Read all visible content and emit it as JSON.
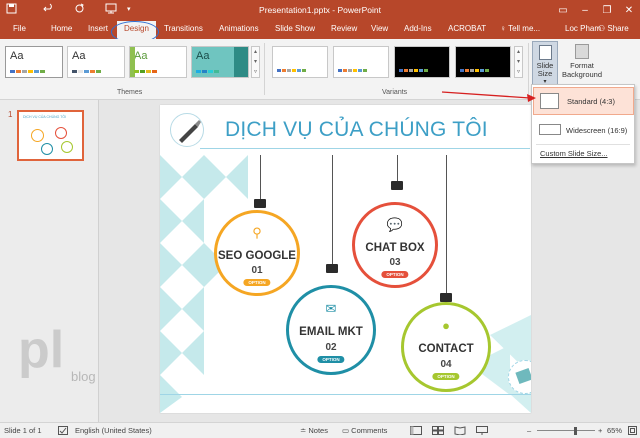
{
  "titlebar": {
    "title": "Presentation1.pptx - PowerPoint",
    "save_icon": "save-icon",
    "undo_icon": "undo-icon",
    "redo_icon": "redo-icon",
    "present_icon": "start-from-beginning-icon",
    "minimize": "–",
    "restore": "❐",
    "close": "✕",
    "ribbon_options": "▭"
  },
  "tabs": [
    "File",
    "Home",
    "Insert",
    "Design",
    "Transitions",
    "Animations",
    "Slide Show",
    "Review",
    "View",
    "Add-Ins",
    "ACROBAT"
  ],
  "active_tab": "Design",
  "tell_me": "♀ Tell me...",
  "user": "Loc Pham",
  "share": "⚇ Share",
  "ribbon": {
    "themes_label": "Themes",
    "variants_label": "Variants",
    "theme_aa": "Aa",
    "slide_size": "Slide Size",
    "slide_size_arrow": "▾",
    "format_background_1": "Format",
    "format_background_2": "Background",
    "theme_colors": [
      "#ffffff",
      "#ffffff",
      "#ffffff",
      "#7fc37c"
    ],
    "variant_colors": [
      "#ffffff",
      "#ffffff",
      "#000000",
      "#000000"
    ]
  },
  "slide_size_menu": {
    "standard": "Standard (4:3)",
    "widescreen": "Widescreen (16:9)",
    "custom": "Custom Slide Size..."
  },
  "slide_panel": {
    "number": "1",
    "thumb_title": "DỊCH VỤ CỦA CHÚNG TÔI"
  },
  "slide": {
    "title": "DỊCH VỤ CỦA CHÚNG TÔI",
    "option_label": "OPTION",
    "items": [
      {
        "name": "SEO GOOGLE",
        "number": "01",
        "color": "#f5a623",
        "icon": "search-icon"
      },
      {
        "name": "CHAT BOX",
        "number": "03",
        "color": "#e5503b",
        "icon": "chat-icon"
      },
      {
        "name": "EMAIL MKT",
        "number": "02",
        "color": "#1f8fa6",
        "icon": "mail-icon"
      },
      {
        "name": "CONTACT",
        "number": "04",
        "color": "#a6c72f",
        "icon": "person-icon"
      }
    ]
  },
  "logo": {
    "mark": "pl",
    "text": "blog"
  },
  "statusbar": {
    "slide": "Slide 1 of 1",
    "language": "English (United States)",
    "notes": "≐ Notes",
    "comments": "▭ Comments",
    "minus": "–",
    "plus": "+",
    "zoom": "65%"
  }
}
